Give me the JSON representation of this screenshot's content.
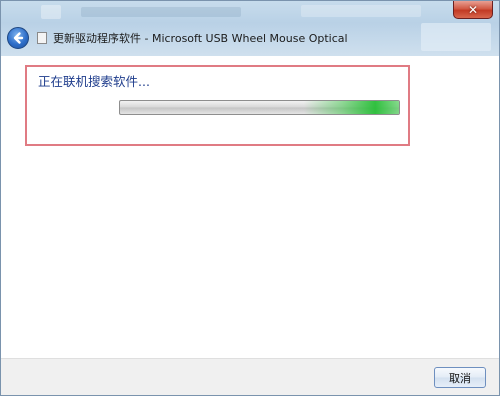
{
  "window": {
    "title": "更新驱动程序软件 - Microsoft USB Wheel Mouse Optical"
  },
  "titlebar": {
    "close_icon": "close-icon",
    "close_color": "#c23a24"
  },
  "nav": {
    "back_icon": "back-arrow-icon",
    "back_color": "#2f6fc9"
  },
  "content": {
    "status": "正在联机搜索软件...",
    "progress_style": "indeterminate marquee",
    "progress_accent": "#28be37"
  },
  "footer": {
    "cancel_label": "取消"
  }
}
